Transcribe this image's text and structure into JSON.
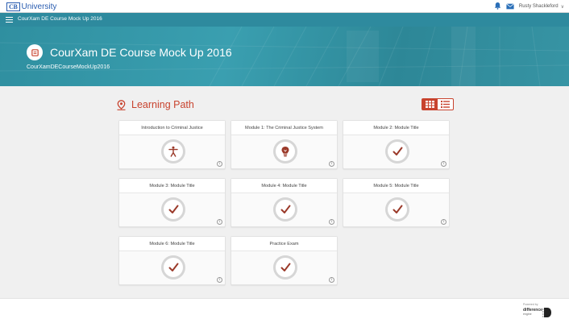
{
  "brand": {
    "logo_box": "CB",
    "logo_text": "University",
    "color": "#2a5db0"
  },
  "topbar": {
    "user_name": "Rusty Shackleford",
    "bell_icon": "bell-icon",
    "mail_icon": "mail-icon"
  },
  "navbar": {
    "title": "CourXam DE Course Mock Up 2016",
    "bg": "#2e8a9e"
  },
  "banner": {
    "course_title": "CourXam DE Course Mock Up 2016",
    "course_code": "CourXamDECourseMockUp2016"
  },
  "learning_path": {
    "title": "Learning Path",
    "accent": "#c8432e",
    "modules": [
      {
        "title": "Introduction to Criminal Justice",
        "icon": "person-icon"
      },
      {
        "title": "Module 1: The Criminal Justice System",
        "icon": "lightbulb-icon"
      },
      {
        "title": "Module 2: Module Title",
        "icon": "check-icon"
      },
      {
        "title": "Module 3: Module Title",
        "icon": "check-icon"
      },
      {
        "title": "Module 4: Module Title",
        "icon": "check-icon"
      },
      {
        "title": "Module 5: Module Title",
        "icon": "check-icon"
      },
      {
        "title": "Module 6: Module Title",
        "icon": "check-icon"
      },
      {
        "title": "Practice Exam",
        "icon": "check-icon"
      }
    ]
  },
  "footer": {
    "powered_by": "Powered by",
    "company_line1": "difference",
    "company_line2": "engine"
  }
}
